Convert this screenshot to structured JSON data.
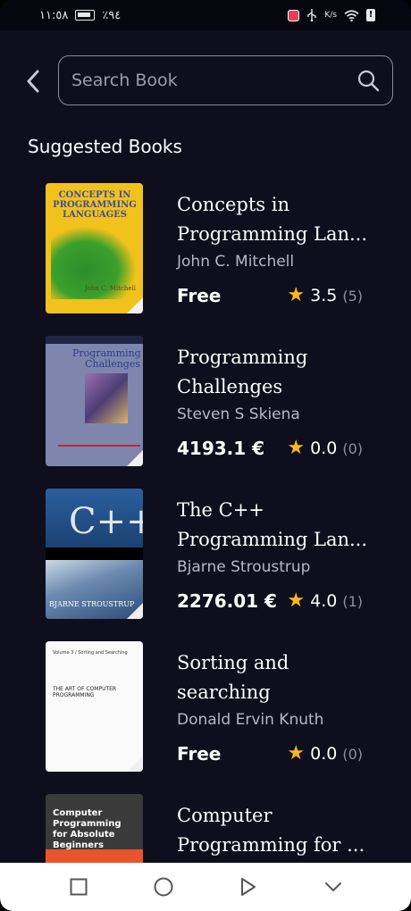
{
  "status_bar": {
    "time": "١١:٥٨",
    "battery": "٪٩٤",
    "speed_unit": "K/s"
  },
  "search": {
    "placeholder": "Search Book",
    "value": ""
  },
  "section_title": "Suggested Books",
  "books": [
    {
      "title": "Concepts in Programming Lan...",
      "author": "John C. Mitchell",
      "price": "Free",
      "rating": "3.5",
      "rating_count": "(5)",
      "cover_text": [
        "CONCEPTS IN PROGRAMMING LANGUAGES",
        "John C. Mitchell"
      ]
    },
    {
      "title": "Programming Challenges",
      "author": "Steven S Skiena",
      "price": "4193.1 €",
      "rating": "0.0",
      "rating_count": "(0)",
      "cover_text": [
        "Programming Challenges"
      ]
    },
    {
      "title": "The C++ Programming Lan...",
      "author": "Bjarne Stroustrup",
      "price": "2276.01 €",
      "rating": "4.0",
      "rating_count": "(1)",
      "cover_text": [
        "C++",
        "BJARNE STROUSTRUP"
      ]
    },
    {
      "title": "Sorting and searching",
      "author": "Donald Ervin Knuth",
      "price": "Free",
      "rating": "0.0",
      "rating_count": "(0)",
      "cover_text": [
        "Volume 3 / Sorting and Searching",
        "THE ART OF COMPUTER PROGRAMMING"
      ]
    },
    {
      "title": "Computer Programming for ...",
      "author": "",
      "price": "",
      "rating": "",
      "rating_count": "",
      "cover_text": [
        "Computer Programming for Absolute Beginners"
      ]
    }
  ],
  "colors": {
    "background": "#0f0e1d",
    "star": "#f5b821",
    "muted": "#b8b7c4"
  },
  "nav": {
    "icons": [
      "square-recents-icon",
      "circle-home-icon",
      "triangle-back-icon",
      "chevron-down-icon"
    ]
  }
}
